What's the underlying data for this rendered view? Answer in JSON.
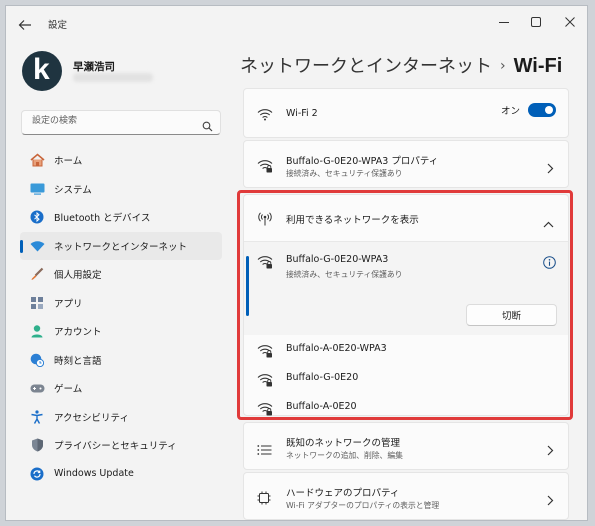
{
  "window": {
    "title": "設定"
  },
  "user": {
    "name": "早瀬浩司",
    "avatar_letter": "k"
  },
  "search": {
    "placeholder": "設定の検索"
  },
  "sidebar": {
    "items": [
      {
        "label": "ホーム",
        "icon": "home-icon"
      },
      {
        "label": "システム",
        "icon": "system-icon"
      },
      {
        "label": "Bluetooth とデバイス",
        "icon": "bluetooth-icon"
      },
      {
        "label": "ネットワークとインターネット",
        "icon": "wifi-icon",
        "selected": true
      },
      {
        "label": "個人用設定",
        "icon": "brush-icon"
      },
      {
        "label": "アプリ",
        "icon": "apps-icon"
      },
      {
        "label": "アカウント",
        "icon": "account-icon"
      },
      {
        "label": "時刻と言語",
        "icon": "globe-clock-icon"
      },
      {
        "label": "ゲーム",
        "icon": "gamepad-icon"
      },
      {
        "label": "アクセシビリティ",
        "icon": "accessibility-icon"
      },
      {
        "label": "プライバシーとセキュリティ",
        "icon": "shield-icon"
      },
      {
        "label": "Windows Update",
        "icon": "update-icon"
      }
    ]
  },
  "breadcrumb": {
    "parent": "ネットワークとインターネット",
    "separator": "›",
    "current": "Wi-Fi"
  },
  "wifi": {
    "label": "Wi-Fi 2",
    "toggle_label": "オン",
    "enabled": true
  },
  "properties": {
    "title": "Buffalo-G-0E20-WPA3 プロパティ",
    "subtitle": "接続済み、セキュリティ保護あり"
  },
  "available": {
    "title": "利用できるネットワークを表示",
    "connected": {
      "name": "Buffalo-G-0E20-WPA3",
      "status": "接続済み、セキュリティ保護あり",
      "disconnect_label": "切断"
    },
    "networks": [
      {
        "name": "Buffalo-A-0E20-WPA3"
      },
      {
        "name": "Buffalo-G-0E20"
      },
      {
        "name": "Buffalo-A-0E20"
      }
    ]
  },
  "known": {
    "title": "既知のネットワークの管理",
    "subtitle": "ネットワークの追加、削除、編集"
  },
  "hardware": {
    "title": "ハードウェアのプロパティ",
    "subtitle": "Wi-Fi アダプターのプロパティの表示と管理"
  },
  "colors": {
    "accent": "#005fb8",
    "highlight": "#e03a3a"
  }
}
